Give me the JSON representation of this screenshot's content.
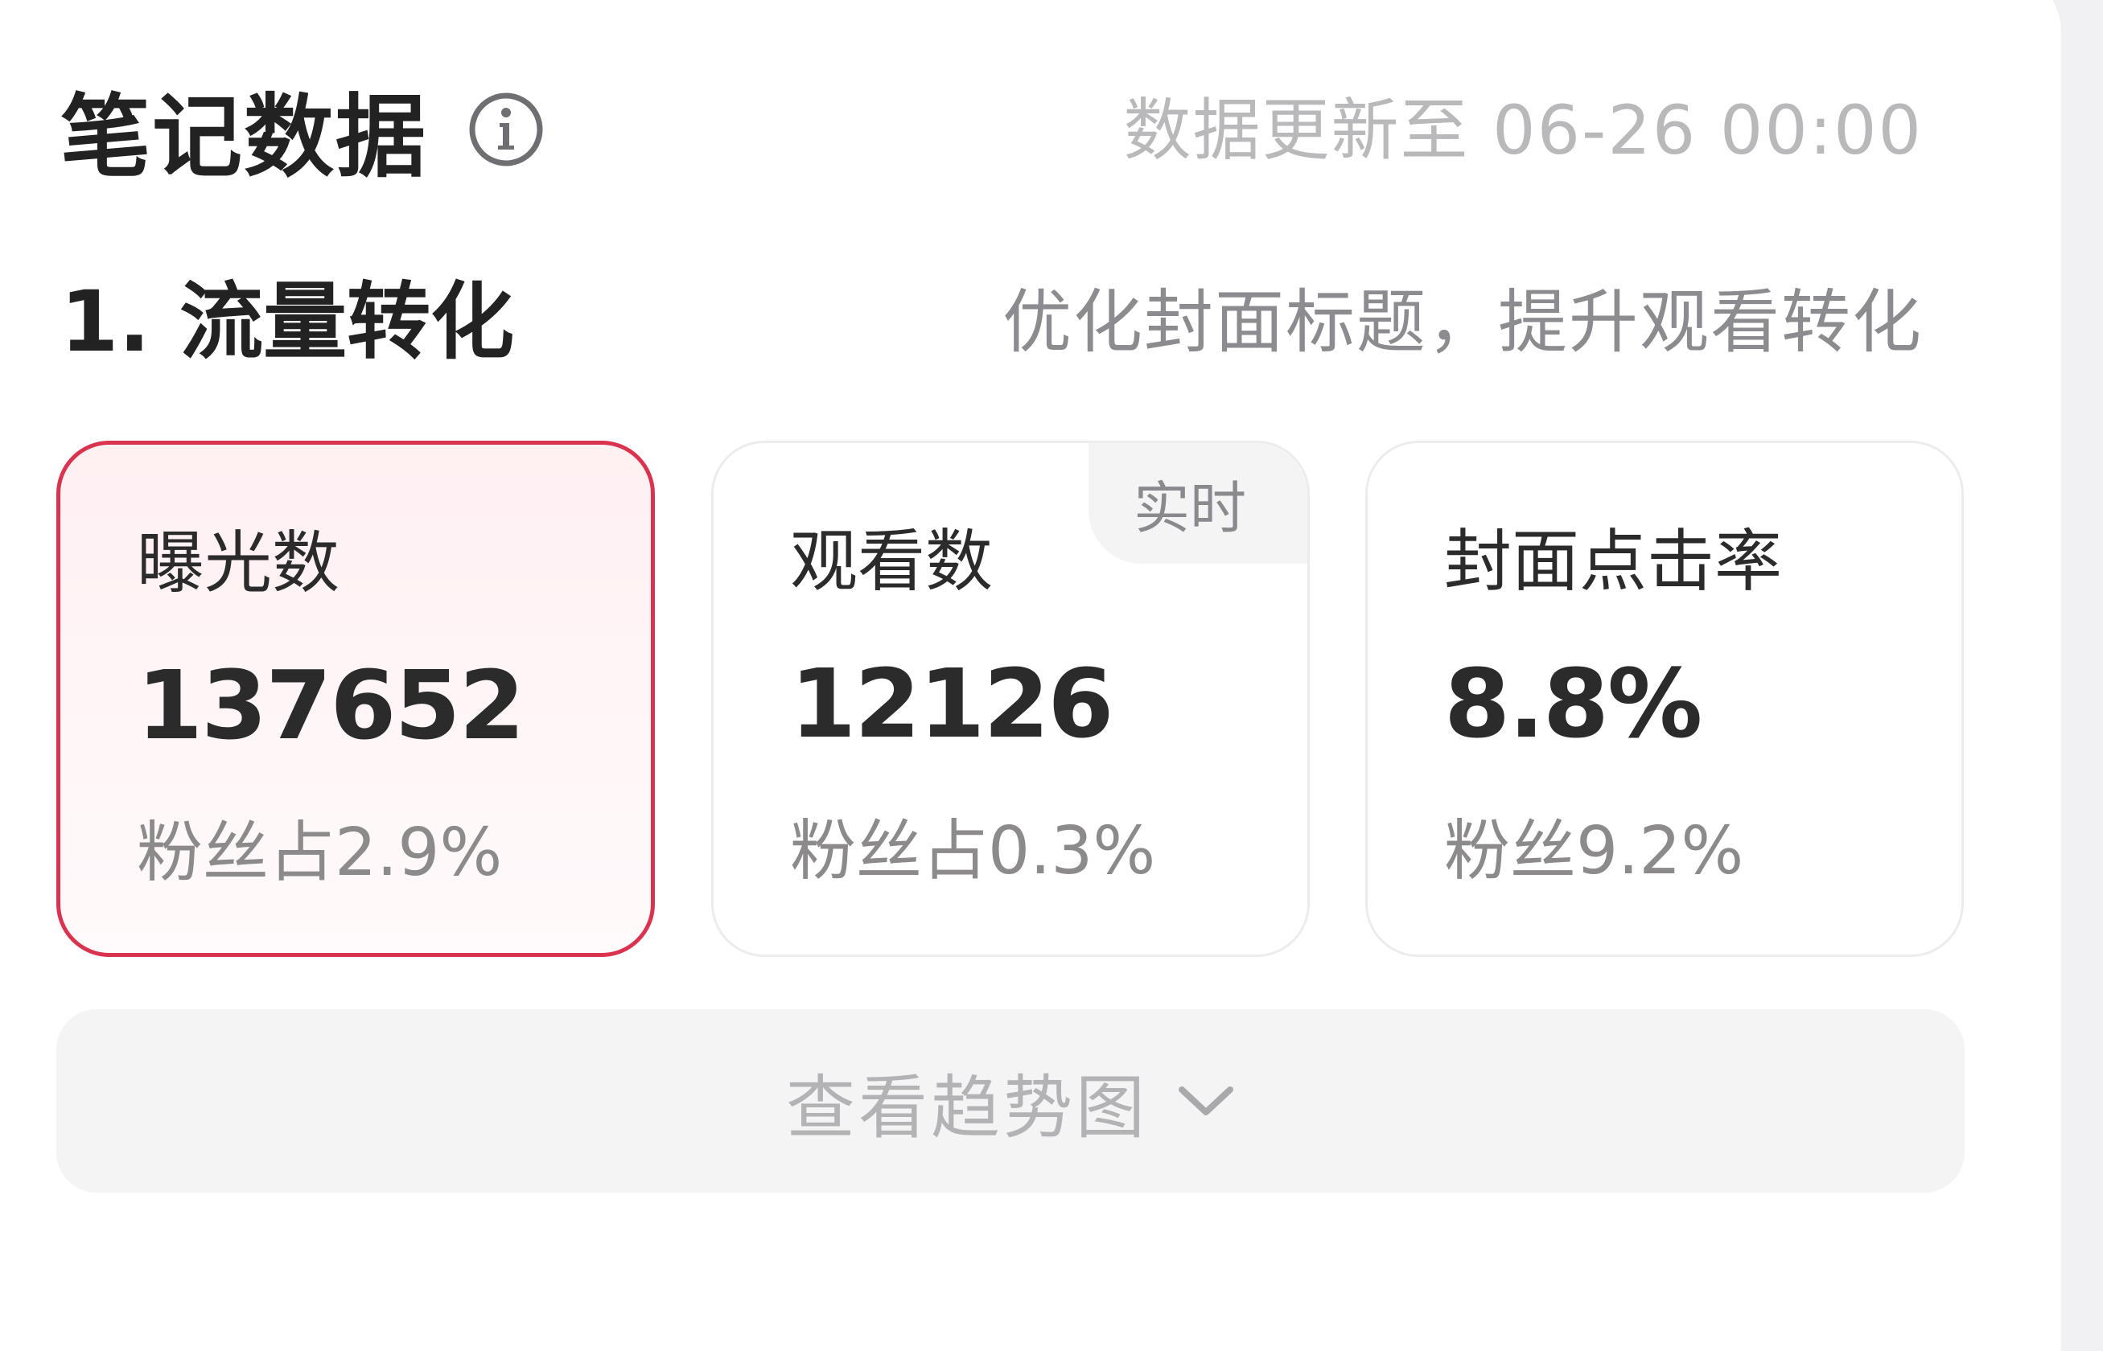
{
  "header": {
    "title": "笔记数据",
    "update_time": "数据更新至 06-26 00:00"
  },
  "section": {
    "title": "1. 流量转化",
    "hint": "优化封面标题，提升观看转化"
  },
  "metrics": [
    {
      "label": "曝光数",
      "value": "137652",
      "sub": "粉丝占2.9%",
      "selected": true
    },
    {
      "label": "观看数",
      "value": "12126",
      "sub": "粉丝占0.3%",
      "badge": "实时"
    },
    {
      "label": "封面点击率",
      "value": "8.8%",
      "sub": "粉丝9.2%"
    }
  ],
  "trend_button": {
    "label": "查看趋势图",
    "icon": "chevron-down-icon"
  },
  "colors": {
    "accent": "#d9334f",
    "active_bg": "#fff0f2",
    "muted_text": "#b9b9bc"
  }
}
